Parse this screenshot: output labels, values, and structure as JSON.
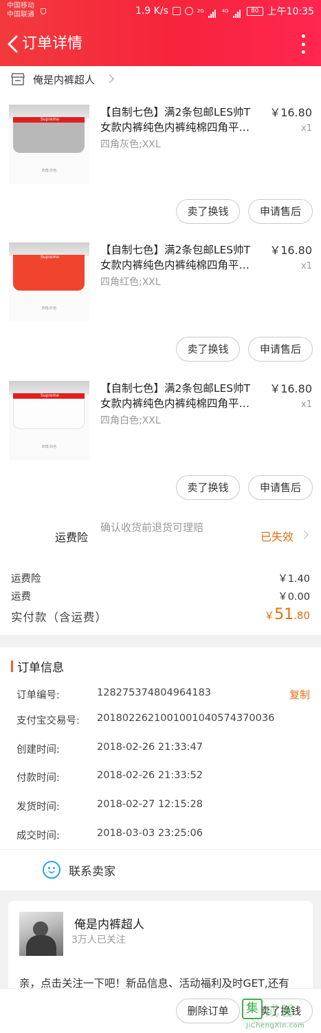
{
  "status_bar": {
    "carrier1": "中国移动",
    "carrier2": "中国联通",
    "speed": "1.9 K/s",
    "net1": "2G",
    "net2": "4G",
    "battery": "80",
    "time": "上午10:35"
  },
  "header": {
    "title": "订单详情",
    "back_icon": "chevron-left-icon",
    "more_icon": "more-vertical-icon",
    "gradient": [
      "#f23a3c",
      "#ff2650"
    ]
  },
  "shop": {
    "name": "俺是内裤超人",
    "icon": "store-icon"
  },
  "items": [
    {
      "title": "【自制七色】满2条包邮LES帅T女款内裤纯色内裤纯棉四角平…",
      "title_line1": "【自制七色】满2条包邮LES帅T",
      "title_line2": "女款内裤纯色内裤纯棉四角平…",
      "sku": "四角灰色;XXL",
      "price": "￥16.80",
      "qty": "x1",
      "color": "#b8b8b8",
      "thumb_caption": "四角/灰色",
      "band_text": "Supreme",
      "sell_label": "卖了换钱",
      "aftersale_label": "申请售后"
    },
    {
      "title": "【自制七色】满2条包邮LES帅T女款内裤纯色内裤纯棉四角平…",
      "title_line1": "【自制七色】满2条包邮LES帅T",
      "title_line2": "女款内裤纯色内裤纯棉四角平…",
      "sku": "四角红色;XXL",
      "price": "￥16.80",
      "qty": "x1",
      "color": "#f0442c",
      "thumb_caption": "四角/红色",
      "band_text": "Supreme",
      "sell_label": "卖了换钱",
      "aftersale_label": "申请售后"
    },
    {
      "title": "【自制七色】满2条包邮LES帅T女款内裤纯色内裤纯棉四角平…",
      "title_line1": "【自制七色】满2条包邮LES帅T",
      "title_line2": "女款内裤纯色内裤纯棉四角平…",
      "sku": "四角白色;XXL",
      "price": "￥16.80",
      "qty": "x1",
      "color": "#fdfdfd",
      "thumb_caption": "四角/白色",
      "band_text": "Supreme",
      "sell_label": "卖了换钱",
      "aftersale_label": "申请售后"
    }
  ],
  "insurance": {
    "label": "运费险",
    "desc": "确认收货前退货可理赔",
    "status": "已失效",
    "status_color": "#e36f12"
  },
  "fees": [
    {
      "label": "运费险",
      "value": "￥1.40"
    },
    {
      "label": "运费",
      "value": "￥0.00"
    }
  ],
  "total": {
    "label": "实付款（含运费）",
    "currency": "￥",
    "integer": "51",
    "decimal": ".80"
  },
  "order_info": {
    "title": "订单信息",
    "copy_label": "复制",
    "rows": [
      {
        "key": "订单编号:",
        "value": "128275374804964183"
      },
      {
        "key": "支付宝交易号:",
        "value": "2018022621001001040574370036"
      },
      {
        "key": "创建时间:",
        "value": "2018-02-26 21:33:47"
      },
      {
        "key": "付款时间:",
        "value": "2018-02-26 21:33:52"
      },
      {
        "key": "发货时间:",
        "value": "2018-02-27 12:15:28"
      },
      {
        "key": "成交时间:",
        "value": "2018-03-03 23:25:06"
      }
    ]
  },
  "contact": {
    "label": "联系卖家",
    "icon": "chat-smile-icon"
  },
  "seller_card": {
    "name": "俺是内裤超人",
    "followers": "3万人已关注",
    "message": "亲，点击关注一下吧！新品信息、活动福利及时GET,还有"
  },
  "bottom_bar": {
    "delete_label": "删除订单",
    "sell_label": "卖了换钱"
  },
  "watermark": {
    "glyph": "集",
    "brand": "成馨",
    "url": "JiChengXin.com"
  }
}
